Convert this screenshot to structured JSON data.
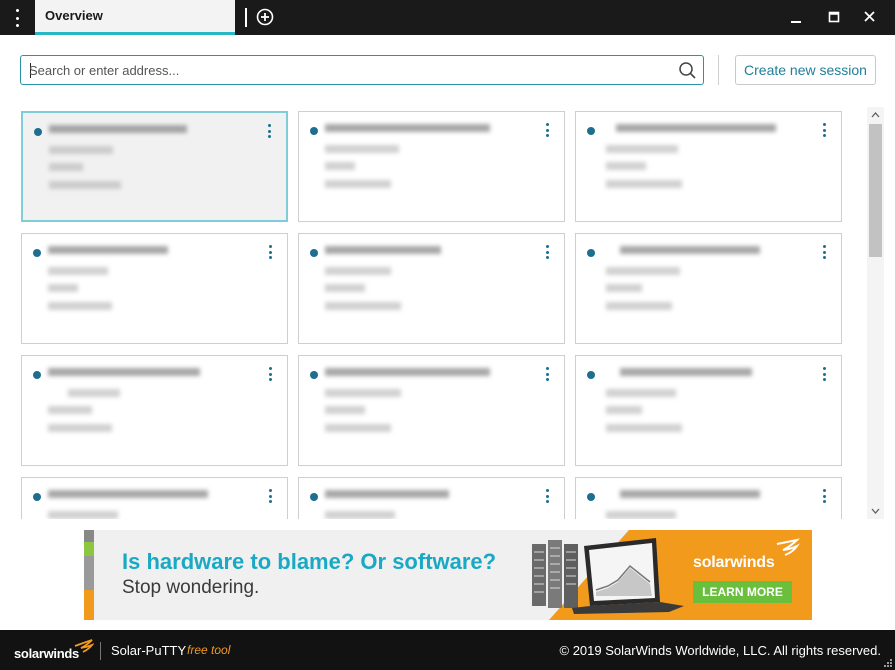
{
  "window": {
    "tab_label": "Overview"
  },
  "search": {
    "placeholder": "Search or enter address..."
  },
  "toolbar": {
    "create_session_label": "Create new session"
  },
  "sessions": {
    "count_visible": 12,
    "selected_index": 0
  },
  "ad": {
    "headline": "Is hardware to blame? Or software?",
    "subline": "Stop wondering.",
    "brand": "solarwinds",
    "cta_label": "LEARN MORE"
  },
  "footer": {
    "brand": "solarwinds",
    "product": "Solar-PuTTY",
    "free_label": "free tool",
    "copyright": "© 2019 SolarWinds Worldwide, LLC. All rights reserved."
  },
  "colors": {
    "accent": "#29b6c5",
    "link": "#1f7f9b",
    "status_dot": "#1e6f8f",
    "brand_orange": "#f29a1c",
    "cta_green": "#6abf3d"
  },
  "icons": {
    "menu": "menu-dots-icon",
    "add_tab": "plus-circle-icon",
    "search": "search-icon",
    "minimize": "minimize-icon",
    "maximize": "maximize-icon",
    "close": "close-icon",
    "card_menu": "kebab-icon"
  }
}
